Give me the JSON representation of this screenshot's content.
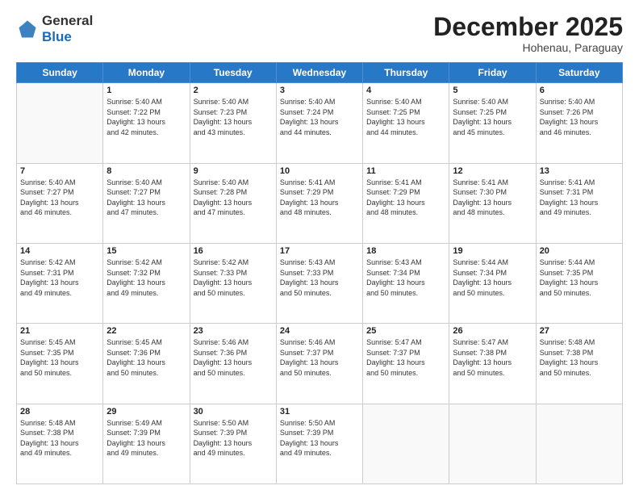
{
  "logo": {
    "general": "General",
    "blue": "Blue"
  },
  "header": {
    "month": "December 2025",
    "location": "Hohenau, Paraguay"
  },
  "days_of_week": [
    "Sunday",
    "Monday",
    "Tuesday",
    "Wednesday",
    "Thursday",
    "Friday",
    "Saturday"
  ],
  "weeks": [
    [
      {
        "day": "",
        "info": ""
      },
      {
        "day": "1",
        "info": "Sunrise: 5:40 AM\nSunset: 7:22 PM\nDaylight: 13 hours\nand 42 minutes."
      },
      {
        "day": "2",
        "info": "Sunrise: 5:40 AM\nSunset: 7:23 PM\nDaylight: 13 hours\nand 43 minutes."
      },
      {
        "day": "3",
        "info": "Sunrise: 5:40 AM\nSunset: 7:24 PM\nDaylight: 13 hours\nand 44 minutes."
      },
      {
        "day": "4",
        "info": "Sunrise: 5:40 AM\nSunset: 7:25 PM\nDaylight: 13 hours\nand 44 minutes."
      },
      {
        "day": "5",
        "info": "Sunrise: 5:40 AM\nSunset: 7:25 PM\nDaylight: 13 hours\nand 45 minutes."
      },
      {
        "day": "6",
        "info": "Sunrise: 5:40 AM\nSunset: 7:26 PM\nDaylight: 13 hours\nand 46 minutes."
      }
    ],
    [
      {
        "day": "7",
        "info": "Sunrise: 5:40 AM\nSunset: 7:27 PM\nDaylight: 13 hours\nand 46 minutes."
      },
      {
        "day": "8",
        "info": "Sunrise: 5:40 AM\nSunset: 7:27 PM\nDaylight: 13 hours\nand 47 minutes."
      },
      {
        "day": "9",
        "info": "Sunrise: 5:40 AM\nSunset: 7:28 PM\nDaylight: 13 hours\nand 47 minutes."
      },
      {
        "day": "10",
        "info": "Sunrise: 5:41 AM\nSunset: 7:29 PM\nDaylight: 13 hours\nand 48 minutes."
      },
      {
        "day": "11",
        "info": "Sunrise: 5:41 AM\nSunset: 7:29 PM\nDaylight: 13 hours\nand 48 minutes."
      },
      {
        "day": "12",
        "info": "Sunrise: 5:41 AM\nSunset: 7:30 PM\nDaylight: 13 hours\nand 48 minutes."
      },
      {
        "day": "13",
        "info": "Sunrise: 5:41 AM\nSunset: 7:31 PM\nDaylight: 13 hours\nand 49 minutes."
      }
    ],
    [
      {
        "day": "14",
        "info": "Sunrise: 5:42 AM\nSunset: 7:31 PM\nDaylight: 13 hours\nand 49 minutes."
      },
      {
        "day": "15",
        "info": "Sunrise: 5:42 AM\nSunset: 7:32 PM\nDaylight: 13 hours\nand 49 minutes."
      },
      {
        "day": "16",
        "info": "Sunrise: 5:42 AM\nSunset: 7:33 PM\nDaylight: 13 hours\nand 50 minutes."
      },
      {
        "day": "17",
        "info": "Sunrise: 5:43 AM\nSunset: 7:33 PM\nDaylight: 13 hours\nand 50 minutes."
      },
      {
        "day": "18",
        "info": "Sunrise: 5:43 AM\nSunset: 7:34 PM\nDaylight: 13 hours\nand 50 minutes."
      },
      {
        "day": "19",
        "info": "Sunrise: 5:44 AM\nSunset: 7:34 PM\nDaylight: 13 hours\nand 50 minutes."
      },
      {
        "day": "20",
        "info": "Sunrise: 5:44 AM\nSunset: 7:35 PM\nDaylight: 13 hours\nand 50 minutes."
      }
    ],
    [
      {
        "day": "21",
        "info": "Sunrise: 5:45 AM\nSunset: 7:35 PM\nDaylight: 13 hours\nand 50 minutes."
      },
      {
        "day": "22",
        "info": "Sunrise: 5:45 AM\nSunset: 7:36 PM\nDaylight: 13 hours\nand 50 minutes."
      },
      {
        "day": "23",
        "info": "Sunrise: 5:46 AM\nSunset: 7:36 PM\nDaylight: 13 hours\nand 50 minutes."
      },
      {
        "day": "24",
        "info": "Sunrise: 5:46 AM\nSunset: 7:37 PM\nDaylight: 13 hours\nand 50 minutes."
      },
      {
        "day": "25",
        "info": "Sunrise: 5:47 AM\nSunset: 7:37 PM\nDaylight: 13 hours\nand 50 minutes."
      },
      {
        "day": "26",
        "info": "Sunrise: 5:47 AM\nSunset: 7:38 PM\nDaylight: 13 hours\nand 50 minutes."
      },
      {
        "day": "27",
        "info": "Sunrise: 5:48 AM\nSunset: 7:38 PM\nDaylight: 13 hours\nand 50 minutes."
      }
    ],
    [
      {
        "day": "28",
        "info": "Sunrise: 5:48 AM\nSunset: 7:38 PM\nDaylight: 13 hours\nand 49 minutes."
      },
      {
        "day": "29",
        "info": "Sunrise: 5:49 AM\nSunset: 7:39 PM\nDaylight: 13 hours\nand 49 minutes."
      },
      {
        "day": "30",
        "info": "Sunrise: 5:50 AM\nSunset: 7:39 PM\nDaylight: 13 hours\nand 49 minutes."
      },
      {
        "day": "31",
        "info": "Sunrise: 5:50 AM\nSunset: 7:39 PM\nDaylight: 13 hours\nand 49 minutes."
      },
      {
        "day": "",
        "info": ""
      },
      {
        "day": "",
        "info": ""
      },
      {
        "day": "",
        "info": ""
      }
    ]
  ]
}
